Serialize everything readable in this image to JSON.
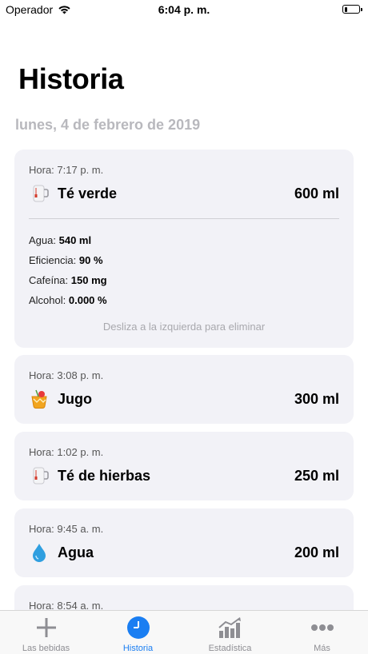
{
  "status_bar": {
    "carrier": "Operador",
    "time": "6:04 p. m.",
    "battery_level": 0.15
  },
  "header": {
    "title": "Historia",
    "date": "lunes, 4 de febrero de 2019"
  },
  "entries": [
    {
      "time_label": "Hora:",
      "time": "7:17 p. m.",
      "name": "Té verde",
      "volume": "600 ml",
      "icon": "tea-mug-icon",
      "details": [
        {
          "label": "Agua:",
          "value": "540 ml"
        },
        {
          "label": "Eficiencia:",
          "value": "90 %"
        },
        {
          "label": "Cafeína:",
          "value": "150 mg"
        },
        {
          "label": "Alcohol:",
          "value": "0.000 %"
        }
      ],
      "hint": "Desliza a la izquierda para eliminar"
    },
    {
      "time_label": "Hora:",
      "time": "3:08 p. m.",
      "name": "Jugo",
      "volume": "300 ml",
      "icon": "juice-icon"
    },
    {
      "time_label": "Hora:",
      "time": "1:02 p. m.",
      "name": "Té de hierbas",
      "volume": "250 ml",
      "icon": "tea-mug-icon"
    },
    {
      "time_label": "Hora:",
      "time": "9:45 a. m.",
      "name": "Agua",
      "volume": "200 ml",
      "icon": "water-drop-icon"
    },
    {
      "time_label": "Hora:",
      "time": "8:54 a. m."
    }
  ],
  "tab_bar": {
    "active": "Historia",
    "accent": "#1a7ef2",
    "tabs": [
      {
        "label": "Las bebidas",
        "icon": "plus-icon"
      },
      {
        "label": "Historia",
        "icon": "clock-icon"
      },
      {
        "label": "Estadística",
        "icon": "stats-icon"
      },
      {
        "label": "Más",
        "icon": "more-icon"
      }
    ]
  }
}
